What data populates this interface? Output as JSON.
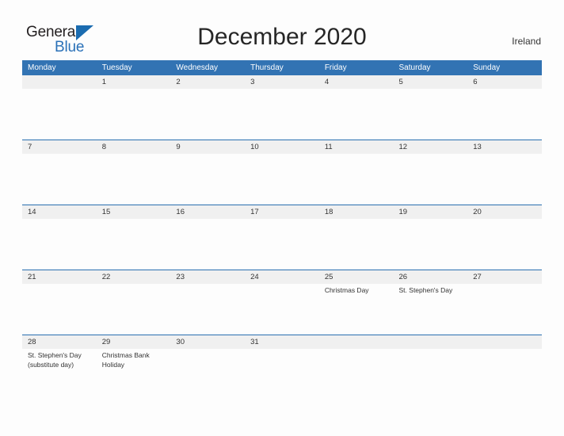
{
  "brand": {
    "name_top": "General",
    "name_bottom": "Blue",
    "accent_color": "#2a71b8"
  },
  "header": {
    "title": "December 2020",
    "country": "Ireland"
  },
  "calendar": {
    "header_color": "#3273b3",
    "band_color": "#f0f0f0",
    "rule_color": "#2a6fb0",
    "weekdays": [
      "Monday",
      "Tuesday",
      "Wednesday",
      "Thursday",
      "Friday",
      "Saturday",
      "Sunday"
    ],
    "weeks": [
      [
        {
          "day": ""
        },
        {
          "day": "1"
        },
        {
          "day": "2"
        },
        {
          "day": "3"
        },
        {
          "day": "4"
        },
        {
          "day": "5"
        },
        {
          "day": "6"
        }
      ],
      [
        {
          "day": "7"
        },
        {
          "day": "8"
        },
        {
          "day": "9"
        },
        {
          "day": "10"
        },
        {
          "day": "11"
        },
        {
          "day": "12"
        },
        {
          "day": "13"
        }
      ],
      [
        {
          "day": "14"
        },
        {
          "day": "15"
        },
        {
          "day": "16"
        },
        {
          "day": "17"
        },
        {
          "day": "18"
        },
        {
          "day": "19"
        },
        {
          "day": "20"
        }
      ],
      [
        {
          "day": "21"
        },
        {
          "day": "22"
        },
        {
          "day": "23"
        },
        {
          "day": "24"
        },
        {
          "day": "25",
          "events": [
            "Christmas Day"
          ]
        },
        {
          "day": "26",
          "events": [
            "St. Stephen's Day"
          ]
        },
        {
          "day": "27"
        }
      ],
      [
        {
          "day": "28",
          "events": [
            "St. Stephen's Day",
            "(substitute day)"
          ]
        },
        {
          "day": "29",
          "events": [
            "Christmas Bank",
            "Holiday"
          ]
        },
        {
          "day": "30"
        },
        {
          "day": "31"
        },
        {
          "day": ""
        },
        {
          "day": ""
        },
        {
          "day": ""
        }
      ]
    ]
  }
}
